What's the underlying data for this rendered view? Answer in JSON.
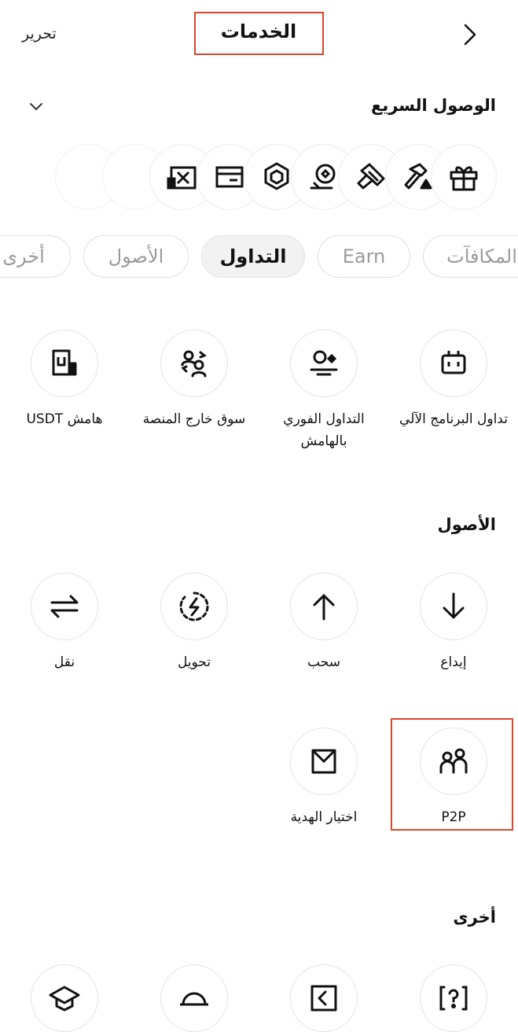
{
  "header": {
    "title": "الخدمات",
    "edit_label": "تحرير",
    "back_icon": "chevron-right-icon"
  },
  "quick_access": {
    "title": "الوصول السريع",
    "collapse_icon": "chevron-down-icon",
    "icons": [
      "gift-icon",
      "hammer-icon",
      "pickaxe-icon",
      "coin-hand-icon",
      "cube-chain-icon",
      "card-icon",
      "cross-chart-icon"
    ]
  },
  "tabs": [
    "المكافآت",
    "Earn",
    "التداول",
    "الأصول",
    "أخرى"
  ],
  "active_tab": "التداول",
  "trading": {
    "items": [
      {
        "label": "تداول البرنامج الآلي",
        "icon": "bot-icon"
      },
      {
        "label": "التداول الفوري بالهامش",
        "icon": "spot-margin-icon"
      },
      {
        "label": "سوق خارج المنصة",
        "icon": "otc-users-icon"
      },
      {
        "label": "هامش USDT",
        "icon": "usdt-margin-icon"
      }
    ]
  },
  "assets": {
    "title": "الأصول",
    "items": [
      {
        "label": "إيداع",
        "icon": "arrow-down-icon"
      },
      {
        "label": "سحب",
        "icon": "arrow-up-icon"
      },
      {
        "label": "تحويل",
        "icon": "convert-bolt-icon"
      },
      {
        "label": "نقل",
        "icon": "transfer-icon"
      },
      {
        "label": "P2P",
        "icon": "p2p-users-icon"
      },
      {
        "label": "اختيار الهدية",
        "icon": "gift-box-icon"
      }
    ]
  },
  "other": {
    "title": "أخرى",
    "icons": [
      "help-icon",
      "swap-box-icon",
      "planet-icon",
      "graduation-cap-icon"
    ]
  }
}
